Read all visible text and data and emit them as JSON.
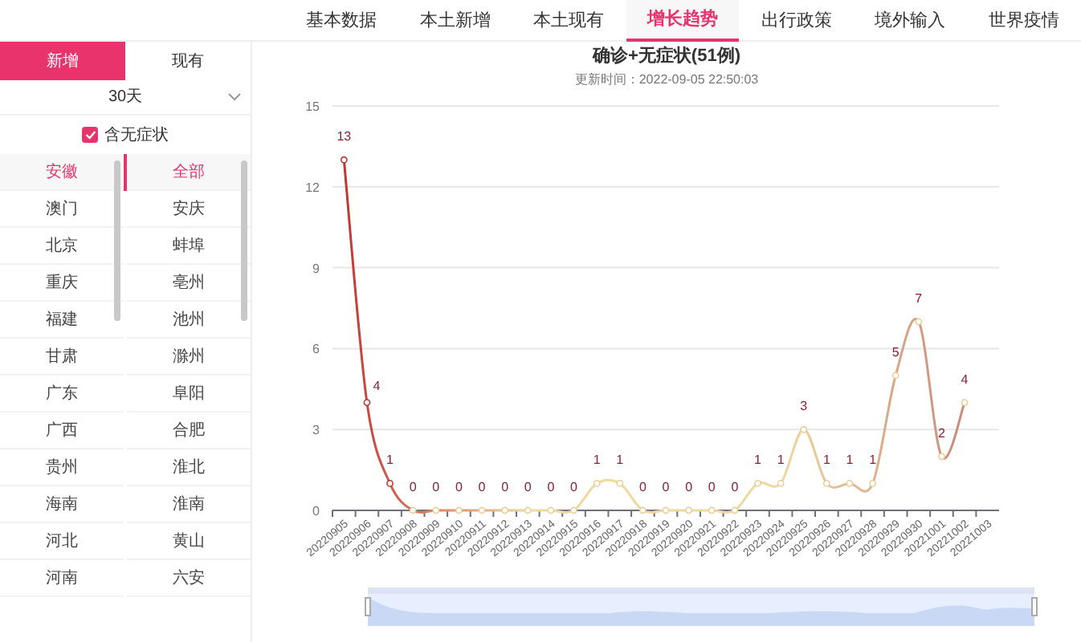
{
  "nav": [
    {
      "label": "基本数据",
      "selected": false
    },
    {
      "label": "本土新增",
      "selected": false
    },
    {
      "label": "本土现有",
      "selected": false
    },
    {
      "label": "增长趋势",
      "selected": true
    },
    {
      "label": "出行政策",
      "selected": false
    },
    {
      "label": "境外输入",
      "selected": false
    },
    {
      "label": "世界疫情",
      "selected": false
    }
  ],
  "mode_tabs": [
    {
      "label": "新增",
      "selected": true
    },
    {
      "label": "现有",
      "selected": false
    }
  ],
  "range_select": {
    "value": "30天"
  },
  "asymptomatic": {
    "label": "含无症状",
    "checked": true
  },
  "provinces": [
    {
      "label": "安徽",
      "selected": true
    },
    {
      "label": "澳门",
      "selected": false
    },
    {
      "label": "北京",
      "selected": false
    },
    {
      "label": "重庆",
      "selected": false
    },
    {
      "label": "福建",
      "selected": false
    },
    {
      "label": "甘肃",
      "selected": false
    },
    {
      "label": "广东",
      "selected": false
    },
    {
      "label": "广西",
      "selected": false
    },
    {
      "label": "贵州",
      "selected": false
    },
    {
      "label": "海南",
      "selected": false
    },
    {
      "label": "河北",
      "selected": false
    },
    {
      "label": "河南",
      "selected": false
    }
  ],
  "cities": [
    {
      "label": "全部",
      "selected": true
    },
    {
      "label": "安庆",
      "selected": false
    },
    {
      "label": "蚌埠",
      "selected": false
    },
    {
      "label": "亳州",
      "selected": false
    },
    {
      "label": "池州",
      "selected": false
    },
    {
      "label": "滁州",
      "selected": false
    },
    {
      "label": "阜阳",
      "selected": false
    },
    {
      "label": "合肥",
      "selected": false
    },
    {
      "label": "淮北",
      "selected": false
    },
    {
      "label": "淮南",
      "selected": false
    },
    {
      "label": "黄山",
      "selected": false
    },
    {
      "label": "六安",
      "selected": false
    }
  ],
  "updated": "更新时间：2022-09-05 22:50:03",
  "zoom": {
    "level": 1
  },
  "chart_data": {
    "type": "line",
    "grid": true,
    "title": "确诊+无症状(51例)",
    "ylim": [
      0,
      15
    ],
    "yticks": [
      0,
      3,
      6,
      9,
      12,
      15
    ],
    "data_labels": true,
    "categories": [
      "20220905",
      "20220906",
      "20220907",
      "20220908",
      "20220909",
      "20220910",
      "20220911",
      "20220912",
      "20220913",
      "20220914",
      "20220915",
      "20220916",
      "20220917",
      "20220918",
      "20220919",
      "20220920",
      "20220921",
      "20220922",
      "20220923",
      "20220924",
      "20220925",
      "20220926",
      "20220927",
      "20220928",
      "20220929",
      "20220930",
      "20221001",
      "20221002",
      "20221003"
    ],
    "series": [
      {
        "color": "#c23531",
        "marker": true,
        "values": [
          13,
          4,
          1,
          0,
          0,
          0,
          0,
          0,
          0,
          0,
          0,
          1,
          1,
          0,
          0,
          0,
          0,
          0,
          1,
          1,
          3,
          1,
          1,
          1,
          5,
          7,
          2,
          4,
          null
        ]
      }
    ]
  }
}
